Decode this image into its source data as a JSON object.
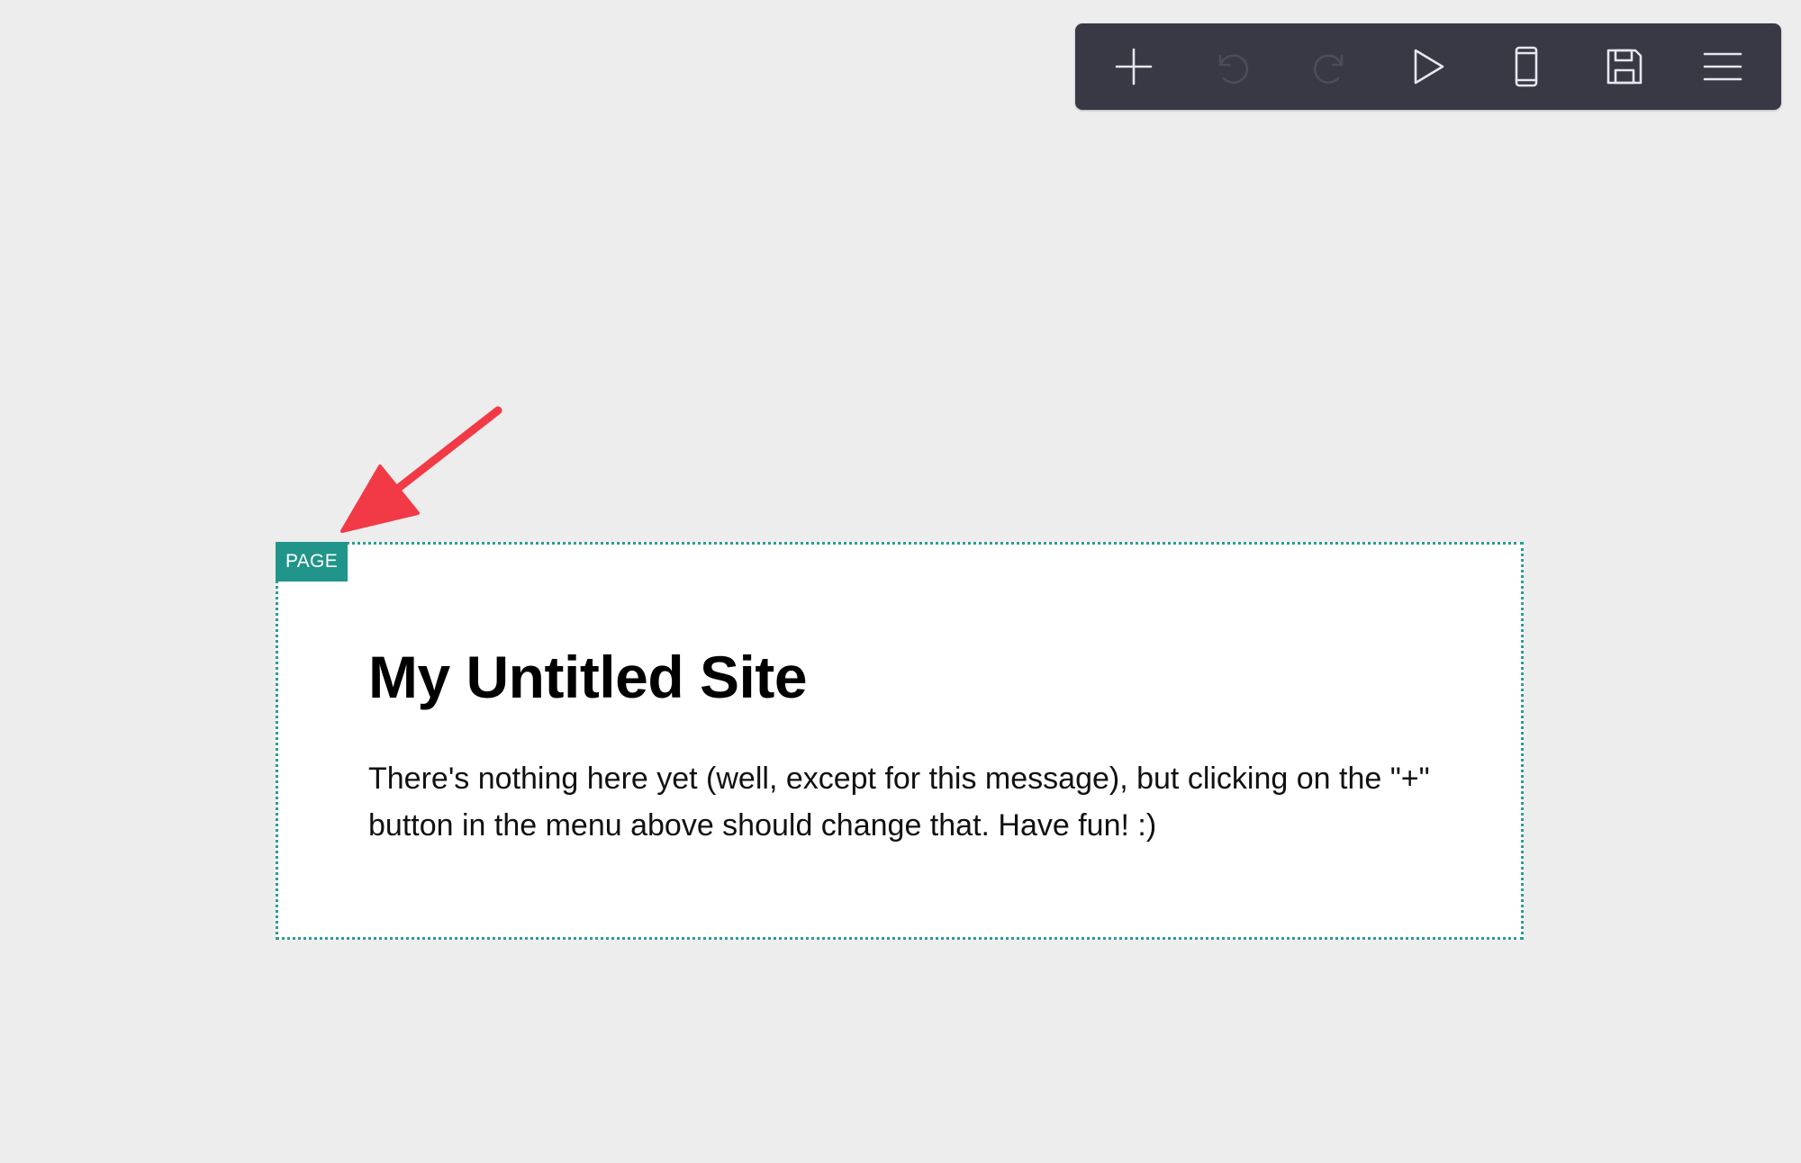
{
  "toolbar": {
    "buttons": [
      {
        "icon": "plus-icon",
        "label": "Add",
        "enabled": true
      },
      {
        "icon": "undo-icon",
        "label": "Undo",
        "enabled": false
      },
      {
        "icon": "redo-icon",
        "label": "Redo",
        "enabled": false
      },
      {
        "icon": "play-icon",
        "label": "Preview",
        "enabled": true
      },
      {
        "icon": "mobile-icon",
        "label": "Mobile view",
        "enabled": true
      },
      {
        "icon": "save-icon",
        "label": "Save",
        "enabled": true
      },
      {
        "icon": "menu-icon",
        "label": "Menu",
        "enabled": true
      }
    ],
    "background_color": "#393945",
    "icon_color": "#e6e6ee",
    "disabled_icon_color": "#4d4d5a"
  },
  "annotation": {
    "arrow_color": "#f23a47"
  },
  "page": {
    "tag_label": "PAGE",
    "title": "My Untitled Site",
    "message": "There's nothing here yet (well, except for this message), but clicking on the \"+\" button in the menu above should change that. Have fun! :)",
    "tag_color": "#22958a",
    "border_color": "#2a9d92"
  }
}
